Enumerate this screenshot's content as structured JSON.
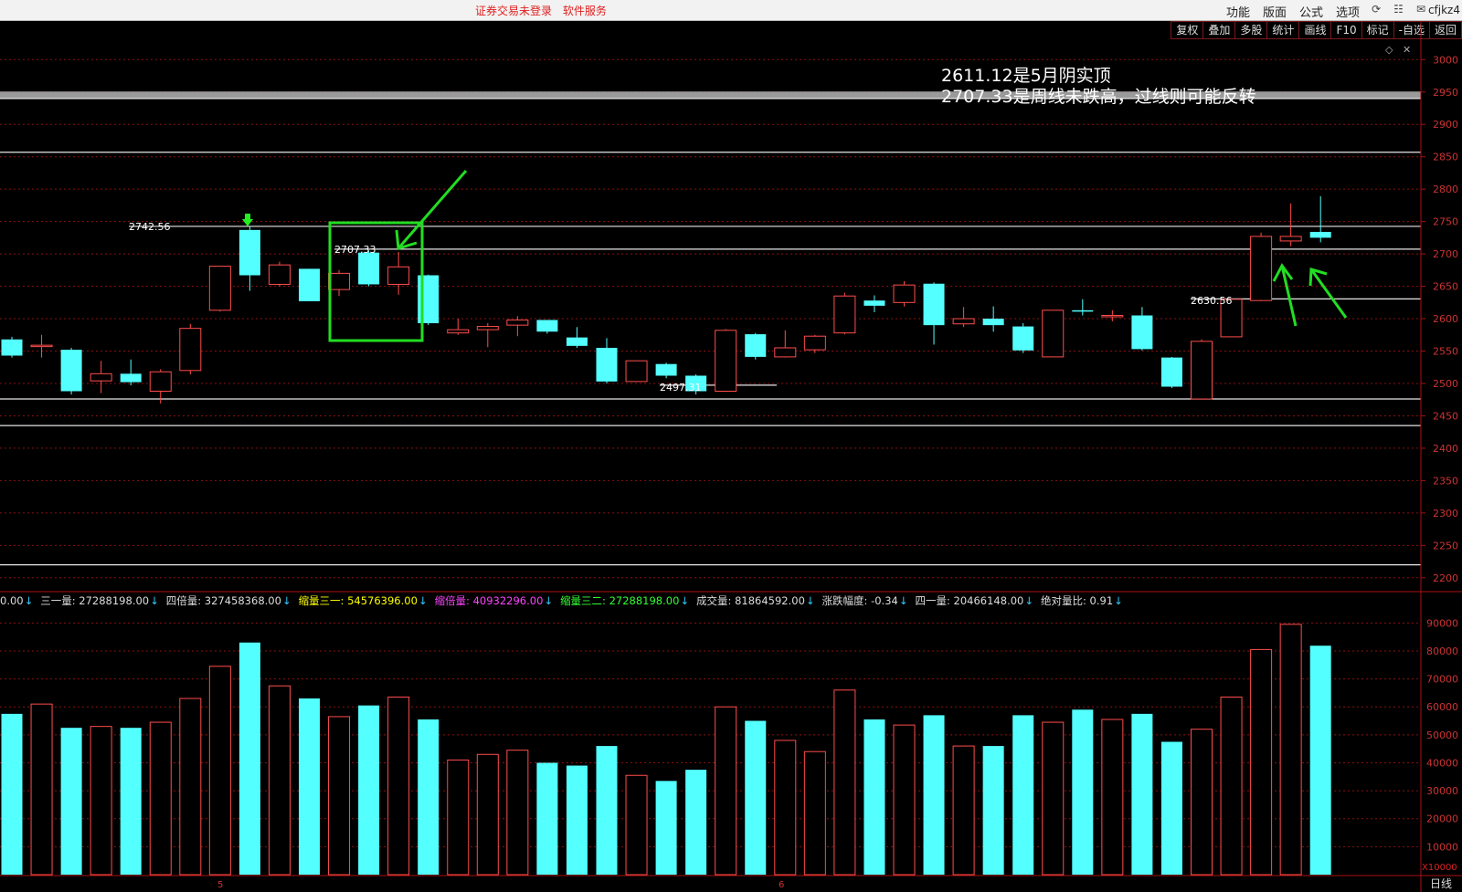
{
  "topbar": {
    "status_text": "证券交易未登录",
    "service_text": "软件服务",
    "menu": [
      "功能",
      "版面",
      "公式",
      "选项"
    ],
    "icons": [
      "refresh-icon",
      "document-icon",
      "mail-icon"
    ],
    "user": "cfjkz4"
  },
  "toolbar": [
    "复权",
    "叠加",
    "多股",
    "统计",
    "画线",
    "F10",
    "标记",
    "-自选",
    "返回"
  ],
  "annotation": {
    "line1": "2611.12是5月阴实顶",
    "line2": "2707.33是周线未跌高，过线则可能反转"
  },
  "price_labels": {
    "p1": "2742.56",
    "p2": "2707.33",
    "p3": "2630.56",
    "p4": "2497.31"
  },
  "indicators": [
    {
      "label": "0.00",
      "color": "#dddddd"
    },
    {
      "label": "三一量: 27288198.00",
      "color": "#dddddd"
    },
    {
      "label": "四倍量: 327458368.00",
      "color": "#dddddd"
    },
    {
      "label": "缩量三一: 54576396.00",
      "color": "#ffff00"
    },
    {
      "label": "缩倍量: 40932296.00",
      "color": "#ff44ff"
    },
    {
      "label": "缩量三二: 27288198.00",
      "color": "#33ff33"
    },
    {
      "label": "成交量: 81864592.00",
      "color": "#dddddd"
    },
    {
      "label": "涨跌幅度: -0.34",
      "color": "#dddddd"
    },
    {
      "label": "四一量: 20466148.00",
      "color": "#dddddd"
    },
    {
      "label": "绝对量比: 0.91",
      "color": "#dddddd"
    }
  ],
  "volume_multiplier": "X10000",
  "day_label": "日线",
  "month_labels": [
    "5",
    "6"
  ],
  "colors": {
    "up": "#ff4c4c",
    "down": "#54ffff",
    "grid": "#8b1010",
    "annotation": "#22dd22"
  },
  "chart_data": {
    "type": "candlestick",
    "y_range": [
      2180,
      3030
    ],
    "y_ticks": [
      2200,
      2250,
      2300,
      2350,
      2400,
      2450,
      2500,
      2550,
      2600,
      2650,
      2700,
      2750,
      2800,
      2850,
      2900,
      2950,
      3000
    ],
    "volume_range": [
      0,
      95000
    ],
    "volume_ticks": [
      10000,
      20000,
      30000,
      40000,
      50000,
      60000,
      70000,
      80000,
      90000
    ],
    "candles": [
      {
        "o": 2568,
        "c": 2543,
        "h": 2572,
        "l": 2540,
        "v": 57500
      },
      {
        "o": 2557,
        "c": 2559,
        "h": 2575,
        "l": 2540,
        "v": 61000
      },
      {
        "o": 2552,
        "c": 2488,
        "h": 2555,
        "l": 2483,
        "v": 52500
      },
      {
        "o": 2504,
        "c": 2515,
        "h": 2535,
        "l": 2485,
        "v": 53000
      },
      {
        "o": 2515,
        "c": 2502,
        "h": 2537,
        "l": 2497,
        "v": 52500
      },
      {
        "o": 2488,
        "c": 2518,
        "h": 2522,
        "l": 2469,
        "v": 54500
      },
      {
        "o": 2520,
        "c": 2585,
        "h": 2592,
        "l": 2514,
        "v": 63000
      },
      {
        "o": 2613,
        "c": 2681,
        "h": 2681,
        "l": 2611,
        "v": 74500
      },
      {
        "o": 2737,
        "c": 2667,
        "h": 2742,
        "l": 2643,
        "v": 83000
      },
      {
        "o": 2653,
        "c": 2683,
        "h": 2688,
        "l": 2650,
        "v": 67500
      },
      {
        "o": 2677,
        "c": 2627,
        "h": 2677,
        "l": 2627,
        "v": 63000
      },
      {
        "o": 2645,
        "c": 2670,
        "h": 2675,
        "l": 2635,
        "v": 56500
      },
      {
        "o": 2702,
        "c": 2653,
        "h": 2705,
        "l": 2650,
        "v": 60500
      },
      {
        "o": 2653,
        "c": 2680,
        "h": 2703,
        "l": 2637,
        "v": 63500
      },
      {
        "o": 2667,
        "c": 2593,
        "h": 2668,
        "l": 2590,
        "v": 55500
      },
      {
        "o": 2578,
        "c": 2583,
        "h": 2600,
        "l": 2575,
        "v": 41000
      },
      {
        "o": 2583,
        "c": 2588,
        "h": 2593,
        "l": 2556,
        "v": 43000
      },
      {
        "o": 2590,
        "c": 2598,
        "h": 2604,
        "l": 2573,
        "v": 44500
      },
      {
        "o": 2598,
        "c": 2580,
        "h": 2598,
        "l": 2577,
        "v": 40000
      },
      {
        "o": 2571,
        "c": 2558,
        "h": 2587,
        "l": 2555,
        "v": 39000
      },
      {
        "o": 2555,
        "c": 2503,
        "h": 2570,
        "l": 2500,
        "v": 46000
      },
      {
        "o": 2503,
        "c": 2535,
        "h": 2535,
        "l": 2503,
        "v": 35500
      },
      {
        "o": 2530,
        "c": 2512,
        "h": 2532,
        "l": 2508,
        "v": 33500
      },
      {
        "o": 2512,
        "c": 2488,
        "h": 2514,
        "l": 2483,
        "v": 37500
      },
      {
        "o": 2488,
        "c": 2582,
        "h": 2584,
        "l": 2487,
        "v": 60000
      },
      {
        "o": 2576,
        "c": 2541,
        "h": 2578,
        "l": 2537,
        "v": 55000
      },
      {
        "o": 2541,
        "c": 2555,
        "h": 2582,
        "l": 2540,
        "v": 48000
      },
      {
        "o": 2552,
        "c": 2573,
        "h": 2575,
        "l": 2547,
        "v": 44000
      },
      {
        "o": 2578,
        "c": 2635,
        "h": 2640,
        "l": 2576,
        "v": 66000
      },
      {
        "o": 2628,
        "c": 2620,
        "h": 2636,
        "l": 2610,
        "v": 55500
      },
      {
        "o": 2625,
        "c": 2652,
        "h": 2658,
        "l": 2619,
        "v": 53500
      },
      {
        "o": 2654,
        "c": 2590,
        "h": 2656,
        "l": 2560,
        "v": 57000
      },
      {
        "o": 2592,
        "c": 2600,
        "h": 2618,
        "l": 2587,
        "v": 46000
      },
      {
        "o": 2600,
        "c": 2590,
        "h": 2619,
        "l": 2580,
        "v": 46000
      },
      {
        "o": 2588,
        "c": 2551,
        "h": 2593,
        "l": 2547,
        "v": 57000
      },
      {
        "o": 2541,
        "c": 2613,
        "h": 2613,
        "l": 2541,
        "v": 54500
      },
      {
        "o": 2613,
        "c": 2612,
        "h": 2630,
        "l": 2605,
        "v": 59000
      },
      {
        "o": 2603,
        "c": 2605,
        "h": 2613,
        "l": 2596,
        "v": 55500
      },
      {
        "o": 2605,
        "c": 2553,
        "h": 2618,
        "l": 2551,
        "v": 57500
      },
      {
        "o": 2540,
        "c": 2495,
        "h": 2541,
        "l": 2493,
        "v": 47500
      },
      {
        "o": 2476,
        "c": 2565,
        "h": 2568,
        "l": 2476,
        "v": 52000
      },
      {
        "o": 2572,
        "c": 2630,
        "h": 2631,
        "l": 2572,
        "v": 63500
      },
      {
        "o": 2628,
        "c": 2727,
        "h": 2733,
        "l": 2627,
        "v": 80500
      },
      {
        "o": 2720,
        "c": 2727,
        "h": 2778,
        "l": 2712,
        "v": 89500
      },
      {
        "o": 2734,
        "c": 2725,
        "h": 2789,
        "l": 2718,
        "v": 81864
      }
    ],
    "reference_lines": [
      2742.56,
      2707.33,
      2630.56,
      2497.31,
      2945,
      2940,
      2857,
      2476,
      2435,
      2220
    ],
    "marker_down_arrow_at_index": 8
  }
}
